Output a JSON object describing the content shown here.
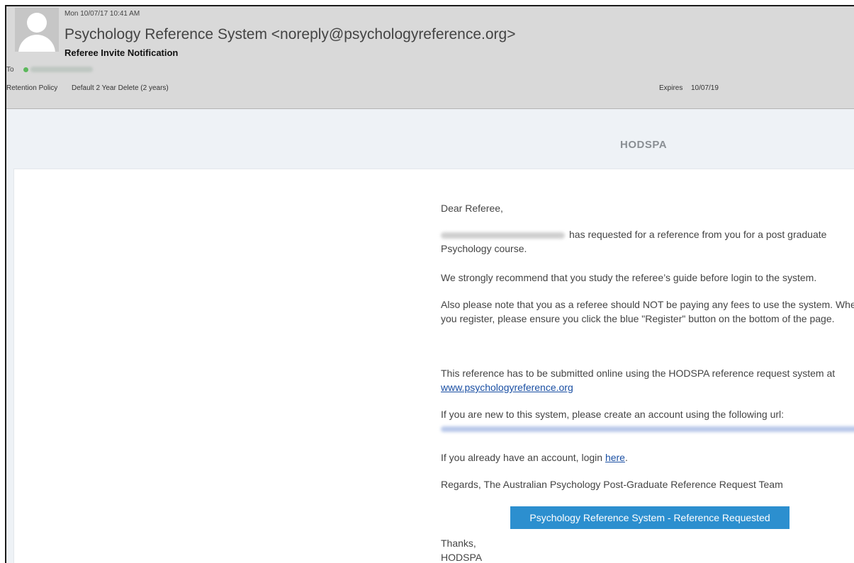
{
  "header": {
    "sent_date": "Mon 10/07/17 10:41 AM",
    "sender": "Psychology Reference System <noreply@psychologyreference.org>",
    "subject": "Referee Invite Notification",
    "to_label": "To",
    "retention_label": "Retention Policy",
    "retention_value": "Default 2 Year Delete (2 years)",
    "expires_label": "Expires",
    "expires_value": "10/07/19"
  },
  "body": {
    "brand": "HODSPA",
    "greeting": "Dear Referee,",
    "request_text": "has requested for a reference from you for a post graduate Psychology course.",
    "recommend_text": "We strongly recommend that you study the referee’s guide before login to the system.",
    "fees_text": "Also please note that you as a referee should NOT be paying any fees to use the system. When you register, please ensure you click the blue \"Register\" button on the bottom of the page.",
    "submit_text": "This reference has to be submitted online using the HODSPA reference request system at",
    "submit_link": "www.psychologyreference.org",
    "new_account_text": "If you are new to this system, please create an account using the following url:",
    "login_text": "If you already have an account, login",
    "login_link": "here",
    "login_period": ".",
    "regards_text": "Regards, The Australian Psychology Post-Graduate Reference Request Team",
    "button_label": "Psychology Reference System - Reference Requested",
    "thanks": "Thanks,",
    "signoff": "HODSPA"
  },
  "colors": {
    "header_bg": "#d9d9d9",
    "body_bg": "#eef2f6",
    "button_bg": "#2c8fcf",
    "link": "#1a4fa3"
  }
}
